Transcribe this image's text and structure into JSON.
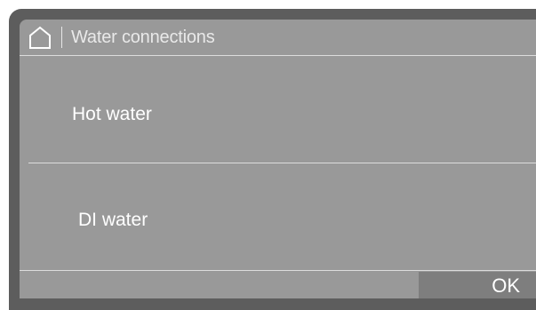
{
  "header": {
    "home_icon": "home-icon",
    "title": "Water connections"
  },
  "menu": {
    "items": [
      {
        "label": "Hot water"
      },
      {
        "label": "DI water"
      }
    ]
  },
  "footer": {
    "ok_label": "OK"
  },
  "colors": {
    "screen_background": "#999999",
    "frame": "#5d5d5d",
    "ok_button": "#7e7e7e",
    "text": "#ffffff"
  }
}
